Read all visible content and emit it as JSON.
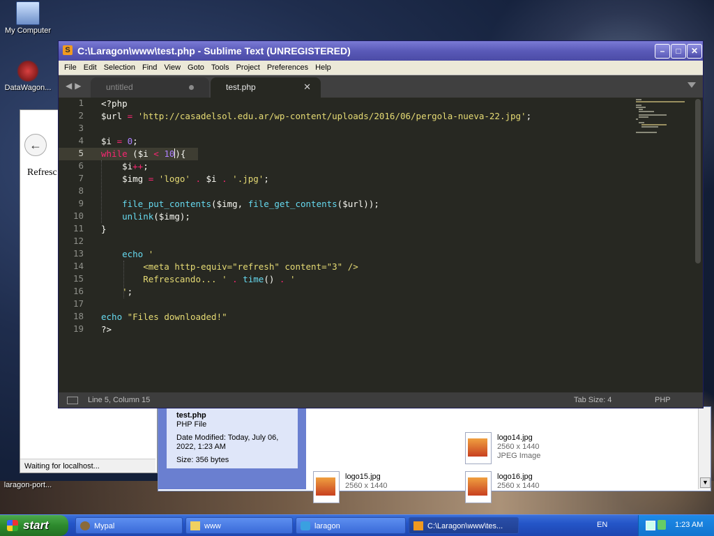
{
  "desktop": {
    "icons": [
      {
        "label": "My Computer"
      },
      {
        "label": "DataWagon..."
      },
      {
        "label": "laragon-port..."
      }
    ]
  },
  "browser": {
    "body_text": "Refresc",
    "status": "Waiting for localhost..."
  },
  "explorer": {
    "details": {
      "filename": "test.php",
      "type": "PHP File",
      "modified": "Date Modified: Today, July 06, 2022, 1:23 AM",
      "size": "Size: 356 bytes"
    },
    "files": [
      {
        "name": "logo14.jpg",
        "dims": "2560 x 1440",
        "type": "JPEG Image"
      },
      {
        "name": "logo15.jpg",
        "dims": "2560 x 1440"
      },
      {
        "name": "logo16.jpg",
        "dims": "2560 x 1440"
      }
    ]
  },
  "sublime": {
    "title": "C:\\Laragon\\www\\test.php - Sublime Text (UNREGISTERED)",
    "menu": [
      "File",
      "Edit",
      "Selection",
      "Find",
      "View",
      "Goto",
      "Tools",
      "Project",
      "Preferences",
      "Help"
    ],
    "tabs": [
      {
        "label": "untitled",
        "active": false
      },
      {
        "label": "test.php",
        "active": true
      }
    ],
    "line_numbers": [
      "1",
      "2",
      "3",
      "4",
      "5",
      "6",
      "7",
      "8",
      "9",
      "10",
      "11",
      "12",
      "13",
      "14",
      "15",
      "16",
      "17",
      "18",
      "19"
    ],
    "code": {
      "l1": "<?php",
      "l2_var": "$url",
      "l2_op": " = ",
      "l2_str": "'http://casadelsol.edu.ar/wp-content/uploads/2016/06/pergola-nueva-22.jpg'",
      "l2_end": ";",
      "l4_var": "$i",
      "l4_op": " = ",
      "l4_num": "0",
      "l4_end": ";",
      "l5_kw": "while",
      "l5_a": " ($i ",
      "l5_op": "<",
      "l5_num1": " 10",
      "l5_b": "){",
      "l6_var": "    $i",
      "l6_op": "++",
      "l6_end": ";",
      "l7_var": "    $img",
      "l7_op": " = ",
      "l7_str1": "'logo'",
      "l7_dot1": " . ",
      "l7_v2": "$i",
      "l7_dot2": " . ",
      "l7_str2": "'.jpg'",
      "l7_end": ";",
      "l9_ind": "    ",
      "l9_f1": "file_put_contents",
      "l9_a": "($img, ",
      "l9_f2": "file_get_contents",
      "l9_b": "($url));",
      "l10_ind": "    ",
      "l10_f": "unlink",
      "l10_a": "($img);",
      "l11": "}",
      "l13_ind": "    ",
      "l13_f": "echo",
      "l13_s": " '",
      "l14": "        <meta http-equiv=\"refresh\" content=\"3\" />",
      "l15_s": "        Refrescando... '",
      "l15_dot1": " . ",
      "l15_f": "time",
      "l15_a": "()",
      "l15_dot2": " . ",
      "l15_s2": "'",
      "l16_s": "    '",
      "l16_end": ";",
      "l18_f": "echo",
      "l18_s": " \"Files downloaded!\"",
      "l19": "?>"
    },
    "status": {
      "position": "Line 5, Column 15",
      "tab_size": "Tab Size: 4",
      "syntax": "PHP"
    }
  },
  "taskbar": {
    "start": "start",
    "items": [
      {
        "label": "Mypal"
      },
      {
        "label": "www"
      },
      {
        "label": "laragon"
      },
      {
        "label": "C:\\Laragon\\www\\tes..."
      }
    ],
    "lang": "EN",
    "clock": "1:23 AM"
  },
  "colors": {
    "keyword": "#f92672",
    "string": "#e6db74",
    "number": "#ae81ff",
    "function": "#66d9ef",
    "editor_bg": "#272822"
  }
}
